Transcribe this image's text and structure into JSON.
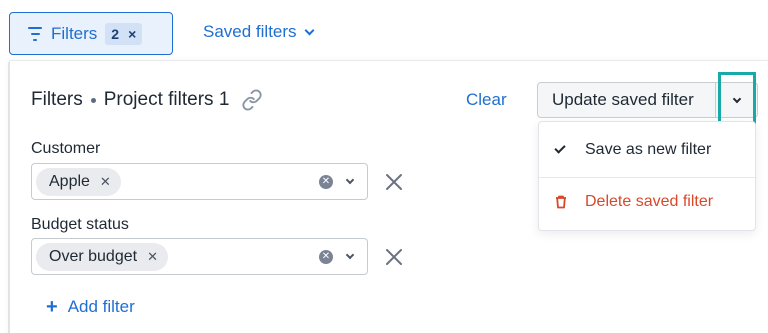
{
  "topbar": {
    "filters_label": "Filters",
    "filters_count": "2",
    "filters_clear_glyph": "×",
    "saved_filters_label": "Saved filters"
  },
  "panel": {
    "title": "Filters",
    "subtitle": "Project filters 1",
    "clear_label": "Clear",
    "update_label": "Update saved filter",
    "menu": {
      "save_new_label": "Save as new filter",
      "delete_label": "Delete saved filter"
    },
    "fields": [
      {
        "label": "Customer",
        "value": "Apple"
      },
      {
        "label": "Budget status",
        "value": "Over budget"
      }
    ],
    "add_filter_label": "Add filter",
    "add_filter_glyph": "+"
  },
  "colors": {
    "accent": "#1f6fd1",
    "danger": "#d9482b",
    "highlight": "#18a9a9"
  },
  "icons": [
    "filter-icon",
    "chevron-down-icon",
    "link-icon",
    "check-icon",
    "trash-icon",
    "clear-icon",
    "close-icon",
    "plus-icon"
  ]
}
